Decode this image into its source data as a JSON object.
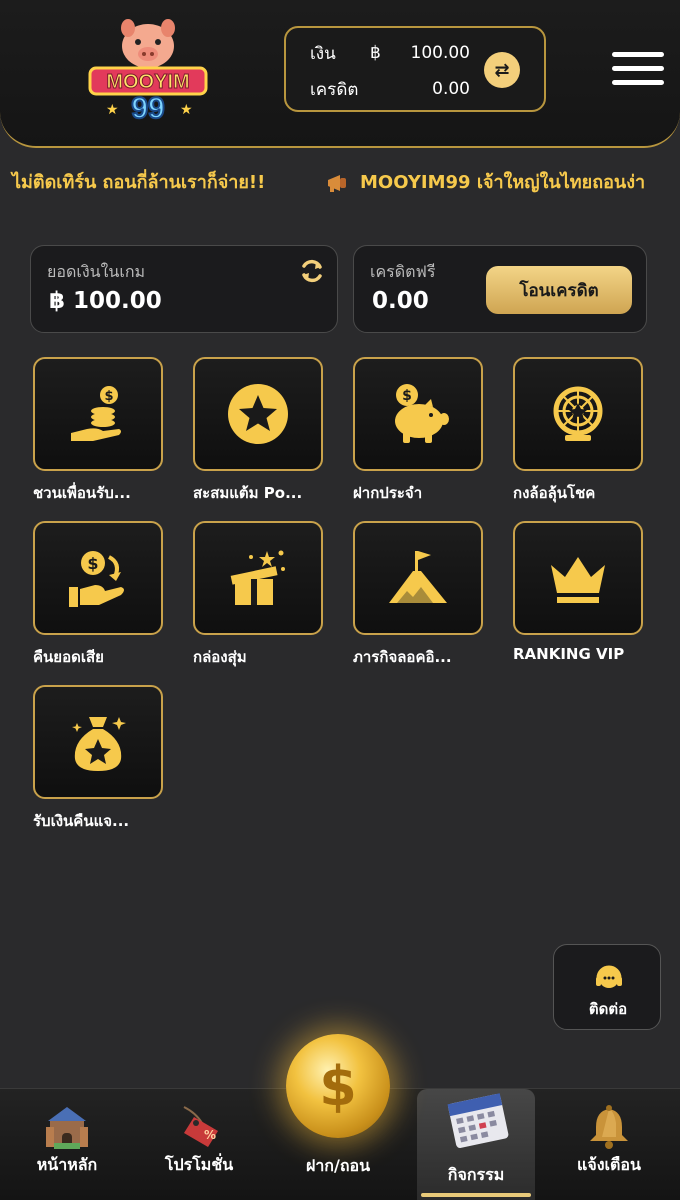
{
  "header": {
    "logo_text": "MOOYIM",
    "logo_number": "99",
    "wallet": {
      "money_label": "เงิน",
      "currency_symbol": "฿",
      "money_value": "100.00",
      "credit_label": "เครดิต",
      "credit_value": "0.00"
    }
  },
  "marquee": {
    "text_left": "ไม่ติดเทิร์น ถอนกี่ล้านเราก็จ่าย!!",
    "text_right": "MOOYIM99 เจ้าใหญ่ในไทยถอนง่า"
  },
  "balance": {
    "game_balance_label": "ยอดเงินในเกม",
    "game_balance_value": "฿ 100.00",
    "free_credit_label": "เครดิตฟรี",
    "free_credit_value": "0.00",
    "transfer_button": "โอนเครดิต"
  },
  "menu_tiles": [
    {
      "label": "ชวนเพื่อนรับ...",
      "icon": "coin-hand-icon"
    },
    {
      "label": "สะสมแต้ม Po...",
      "icon": "star-coin-icon"
    },
    {
      "label": "ฝากประจำ",
      "icon": "piggy-bank-icon"
    },
    {
      "label": "กงล้อลุ้นโชค",
      "icon": "lucky-wheel-icon"
    },
    {
      "label": "คืนยอดเสีย",
      "icon": "cashback-icon"
    },
    {
      "label": "กล่องสุ่ม",
      "icon": "gift-box-icon"
    },
    {
      "label": "ภารกิจลอคอิ...",
      "icon": "mountain-flag-icon"
    },
    {
      "label": "RANKING VIP",
      "icon": "crown-icon"
    },
    {
      "label": "รับเงินคืนแจ...",
      "icon": "money-bag-icon"
    }
  ],
  "contact": {
    "label": "ติดต่อ"
  },
  "bottom_nav": {
    "home": "หน้าหลัก",
    "promotion": "โปรโมชั่น",
    "deposit_withdraw": "ฝาก/ถอน",
    "activities": "กิจกรรม",
    "notifications": "แจ้งเตือน"
  },
  "colors": {
    "gold": "#c9a24b",
    "gold_light": "#f3cf7b",
    "background": "#2a2a2c",
    "marquee_text": "#f6c94c"
  }
}
